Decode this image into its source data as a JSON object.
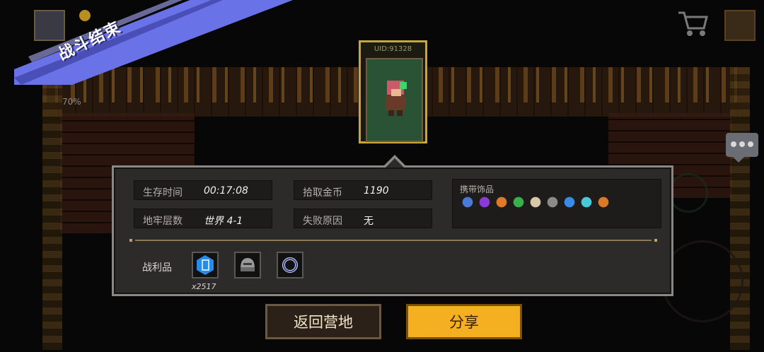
{
  "banner": {
    "title": "战斗结束"
  },
  "hud": {
    "progress_text": "70%"
  },
  "card": {
    "uid": "UID:91328"
  },
  "stats": {
    "survival_time": {
      "label": "生存时间",
      "value": "00:17:08"
    },
    "gold_picked": {
      "label": "拾取金币",
      "value": "1190"
    },
    "dungeon_floor": {
      "label": "地牢层数",
      "value": "世界 4-1"
    },
    "fail_reason": {
      "label": "失败原因",
      "value": "无"
    }
  },
  "accessories": {
    "label": "携带饰品",
    "items": [
      "blue-feather-icon",
      "purple-gem-icon",
      "target-ring-icon",
      "green-clover-icon",
      "bone-horn-icon",
      "spiky-star-icon",
      "blue-crystal-icon",
      "cyan-boot-icon",
      "orange-cloak-icon"
    ],
    "colors": [
      "#4a7ad8",
      "#8a3ad8",
      "#e07a2a",
      "#3ab04a",
      "#d8c8a8",
      "#8a8a8a",
      "#3a8ae8",
      "#4ac8d8",
      "#d87a2a"
    ]
  },
  "loot": {
    "label": "战利品",
    "items": [
      {
        "icon": "blue-energy-gem-icon",
        "count": "x2517"
      },
      {
        "icon": "iron-helmet-icon",
        "count": ""
      },
      {
        "icon": "dark-ring-icon",
        "count": ""
      }
    ]
  },
  "buttons": {
    "back": "返回营地",
    "share": "分享"
  },
  "colors": {
    "share_bg": "#f4b020",
    "banner_bg": "#6a72e8",
    "card_border": "#c9a53a"
  }
}
